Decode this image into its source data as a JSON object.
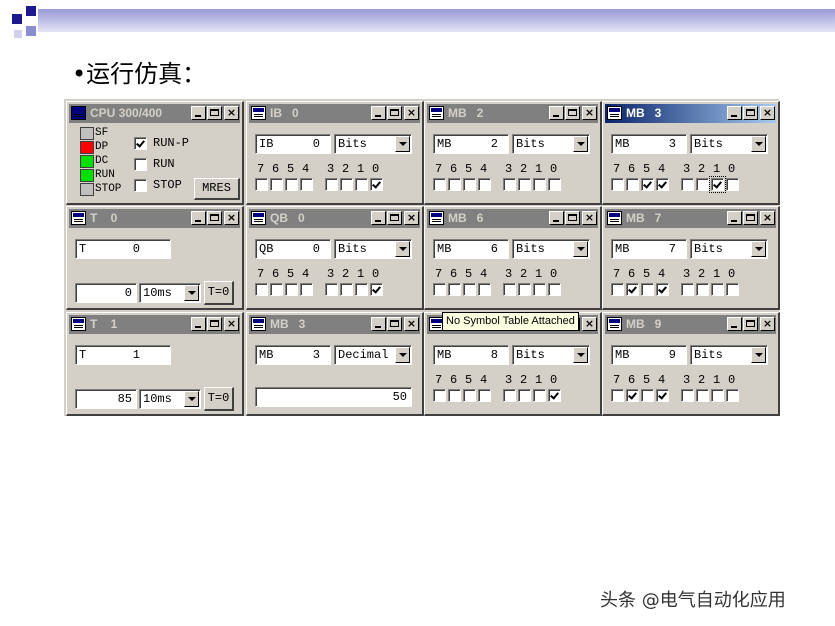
{
  "slide": {
    "title": "•运行仿真：",
    "watermark": "头条 @电气自动化应用"
  },
  "cpu_window": {
    "title": "CPU 300/400",
    "leds": [
      {
        "label": "SF",
        "color": "#c0c0c0"
      },
      {
        "label": "DP",
        "color": "#ff0000"
      },
      {
        "label": "DC",
        "color": "#00e000"
      },
      {
        "label": "RUN",
        "color": "#00e000"
      },
      {
        "label": "STOP",
        "color": "#c0c0c0"
      }
    ],
    "modes": [
      {
        "label": "RUN-P",
        "checked": true
      },
      {
        "label": "RUN",
        "checked": false
      },
      {
        "label": "STOP",
        "checked": false
      }
    ],
    "mres_label": "MRES"
  },
  "bit_labels": [
    "7",
    "6",
    "5",
    "4",
    "3",
    "2",
    "1",
    "0"
  ],
  "windows": {
    "ib0": {
      "title": "IB   0",
      "area": "IB",
      "address": "0",
      "format": "Bits",
      "bits": [
        false,
        false,
        false,
        false,
        false,
        false,
        false,
        true
      ]
    },
    "mb2": {
      "title": "MB   2",
      "area": "MB",
      "address": "2",
      "format": "Bits",
      "bits": [
        false,
        false,
        false,
        false,
        false,
        false,
        false,
        false
      ]
    },
    "mb3a": {
      "title": "MB   3",
      "area": "MB",
      "address": "3",
      "format": "Bits",
      "bits": [
        false,
        false,
        true,
        true,
        false,
        false,
        true,
        false
      ]
    },
    "t0": {
      "title": "T    0",
      "area": "T",
      "address": "0",
      "value": "0",
      "timebase": "10ms",
      "reset_label": "T=0"
    },
    "qb0": {
      "title": "QB   0",
      "area": "QB",
      "address": "0",
      "format": "Bits",
      "bits": [
        false,
        false,
        false,
        false,
        false,
        false,
        false,
        true
      ]
    },
    "mb6": {
      "title": "MB   6",
      "area": "MB",
      "address": "6",
      "format": "Bits",
      "bits": [
        false,
        false,
        false,
        false,
        false,
        false,
        false,
        false
      ]
    },
    "mb7": {
      "title": "MB   7",
      "area": "MB",
      "address": "7",
      "format": "Bits",
      "bits": [
        false,
        true,
        false,
        true,
        false,
        false,
        false,
        false
      ]
    },
    "t1": {
      "title": "T    1",
      "area": "T",
      "address": "1",
      "value": "85",
      "timebase": "10ms",
      "reset_label": "T=0"
    },
    "mb3b": {
      "title": "MB   3",
      "area": "MB",
      "address": "3",
      "format": "Decimal",
      "value": "50"
    },
    "mb8": {
      "title": "",
      "area": "MB",
      "address": "8",
      "format": "Bits",
      "bits": [
        false,
        false,
        false,
        false,
        false,
        false,
        false,
        true
      ]
    },
    "mb9": {
      "title": "MB   9",
      "area": "MB",
      "address": "9",
      "format": "Bits",
      "bits": [
        false,
        true,
        false,
        true,
        false,
        false,
        false,
        false
      ]
    }
  },
  "tooltip": "No Symbol Table Attached",
  "titlebar_buttons": {
    "close": "×"
  }
}
